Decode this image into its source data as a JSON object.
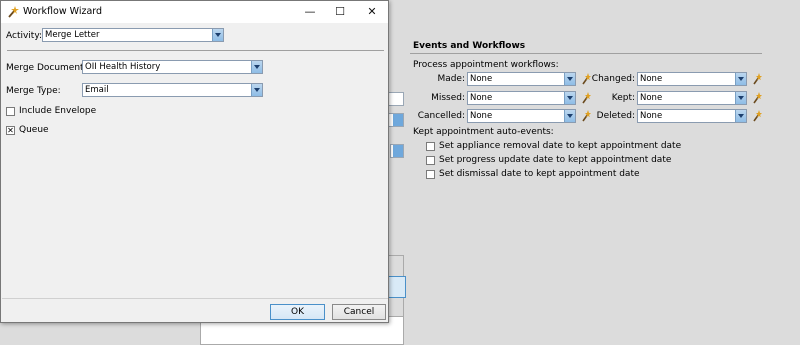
{
  "dialog": {
    "title": "Workflow Wizard",
    "controls": {
      "minimize": "—",
      "maximize": "☐",
      "close": "✕"
    },
    "activity": {
      "label": "Activity:",
      "value": "Merge Letter"
    },
    "merge_document": {
      "label": "Merge Document:",
      "value": "OII Health History"
    },
    "merge_type": {
      "label": "Merge Type:",
      "value": "Email"
    },
    "include_envelope": {
      "label": "Include Envelope",
      "checked": false
    },
    "queue": {
      "label": "Queue",
      "checked": true,
      "mark": "✕"
    },
    "ok_label": "OK",
    "cancel_label": "Cancel"
  },
  "events": {
    "title": "Events and Workflows",
    "process_title": "Process appointment workflows:",
    "left": [
      {
        "label": "Made:",
        "value": "None"
      },
      {
        "label": "Missed:",
        "value": "None"
      },
      {
        "label": "Cancelled:",
        "value": "None"
      }
    ],
    "right": [
      {
        "label": "Changed:",
        "value": "None"
      },
      {
        "label": "Kept:",
        "value": "None"
      },
      {
        "label": "Deleted:",
        "value": "None"
      }
    ],
    "kept_title": "Kept appointment auto-events:",
    "auto_events": [
      {
        "label": "Set appliance removal date to kept appointment date",
        "checked": false
      },
      {
        "label": "Set progress update date to kept appointment date",
        "checked": false
      },
      {
        "label": "Set dismissal date to kept appointment date",
        "checked": false
      }
    ]
  },
  "colors": {
    "accent": "#4a90c9",
    "dropdown": "#8ebde6",
    "dialog_bg": "#f0f0f0",
    "app_bg": "#dcdcdc"
  }
}
